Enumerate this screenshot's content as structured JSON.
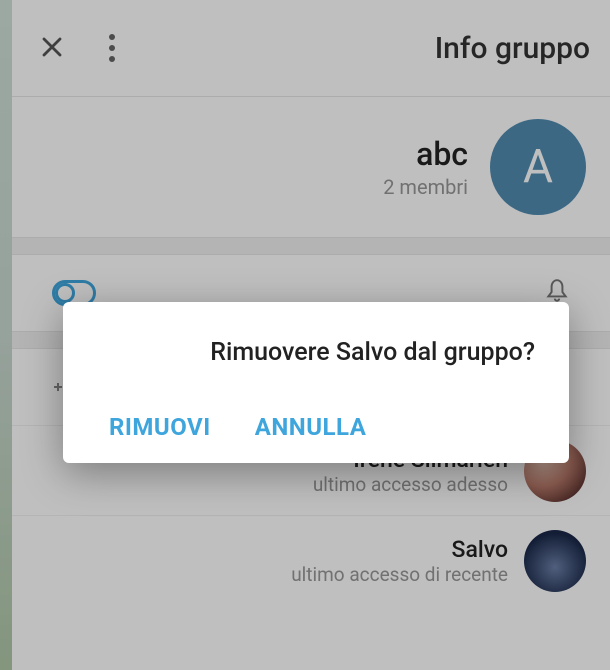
{
  "header": {
    "title": "Info gruppo"
  },
  "group": {
    "name": "abc",
    "members_label": "2 membri",
    "avatar_letter": "A"
  },
  "members": {
    "items": [
      {
        "name": "Irene Silmarien",
        "status": "ultimo accesso adesso"
      },
      {
        "name": "Salvo",
        "status": "ultimo accesso di recente"
      }
    ]
  },
  "dialog": {
    "message": "Rimuovere Salvo dal gruppo?",
    "confirm": "RIMUOVI",
    "cancel": "ANNULLA"
  }
}
